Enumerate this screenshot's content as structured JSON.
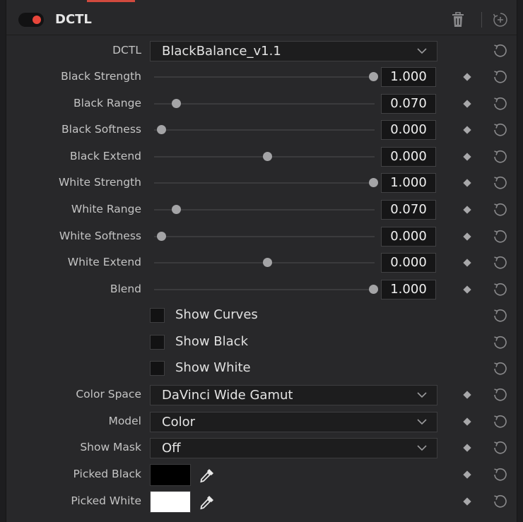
{
  "header": {
    "title": "DCTL",
    "enabled": true,
    "toggle_color": "#e8463b"
  },
  "dctl_row": {
    "label": "DCTL",
    "value": "BlackBalance_v1.1"
  },
  "sliders": [
    {
      "label": "Black Strength",
      "value": "1.000",
      "position": 1.0
    },
    {
      "label": "Black Range",
      "value": "0.070",
      "position": 0.07
    },
    {
      "label": "Black Softness",
      "value": "0.000",
      "position": 0.0
    },
    {
      "label": "Black Extend",
      "value": "0.000",
      "position": 0.5
    },
    {
      "label": "White Strength",
      "value": "1.000",
      "position": 1.0
    },
    {
      "label": "White Range",
      "value": "0.070",
      "position": 0.07
    },
    {
      "label": "White Softness",
      "value": "0.000",
      "position": 0.0
    },
    {
      "label": "White Extend",
      "value": "0.000",
      "position": 0.5
    },
    {
      "label": "Blend",
      "value": "1.000",
      "position": 1.0
    }
  ],
  "checkboxes": [
    {
      "label": "Show Curves",
      "checked": false
    },
    {
      "label": "Show Black",
      "checked": false
    },
    {
      "label": "Show White",
      "checked": false
    }
  ],
  "dropdowns": [
    {
      "label": "Color Space",
      "value": "DaVinci Wide Gamut"
    },
    {
      "label": "Model",
      "value": "Color"
    },
    {
      "label": "Show Mask",
      "value": "Off"
    }
  ],
  "pickers": [
    {
      "label": "Picked Black",
      "color": "#000000"
    },
    {
      "label": "Picked White",
      "color": "#ffffff"
    }
  ]
}
